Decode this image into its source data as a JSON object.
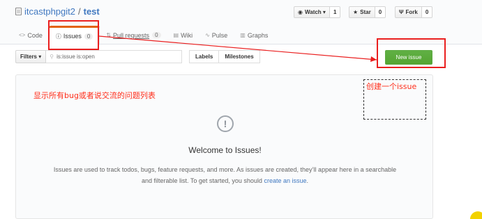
{
  "repo": {
    "owner": "itcastphpgit2",
    "separator": "/",
    "name": "test"
  },
  "social": {
    "watch_label": "Watch ▾",
    "watch_count": "1",
    "star_label": "Star",
    "star_count": "0",
    "fork_label": "Fork",
    "fork_count": "0"
  },
  "tabs": [
    {
      "label": "Code",
      "icon": "code-icon"
    },
    {
      "label": "Issues",
      "count": "0",
      "icon": "issue-opened-icon"
    },
    {
      "label": "Pull requests",
      "count": "0",
      "icon": "git-pull-request-icon"
    },
    {
      "label": "Wiki",
      "icon": "book-icon"
    },
    {
      "label": "Pulse",
      "icon": "pulse-icon"
    },
    {
      "label": "Graphs",
      "icon": "graph-icon"
    }
  ],
  "filter_bar": {
    "filters_label": "Filters ▾",
    "search_value": "is:issue is:open",
    "labels_label": "Labels",
    "milestones_label": "Milestones"
  },
  "new_issue_label": "New issue",
  "blankslate": {
    "title": "Welcome to Issues!",
    "desc_line1": "Issues are used to track todos, bugs, feature requests, and more. As issues are created, they’ll appear here in a searchable",
    "desc_line2_prefix": "and filterable list. To get started, you should",
    "create_link": "create an issue",
    "desc_line2_suffix": "."
  },
  "annotations": {
    "issues_list_note": "显示所有bug或者说交流的问题列表",
    "new_issue_note": "创建一个issue"
  },
  "colors": {
    "annotation": "#ff2e1a",
    "new_issue": "#55a532",
    "link": "#4078c0",
    "active_tab": "#e36209"
  }
}
